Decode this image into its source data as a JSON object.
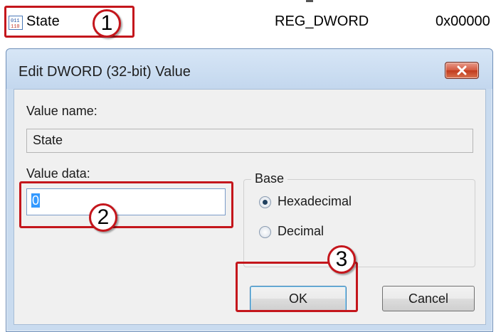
{
  "registry_row": {
    "name": "State",
    "type": "REG_DWORD",
    "data": "0x00000"
  },
  "dialog": {
    "title": "Edit DWORD (32-bit) Value",
    "value_name_label": "Value name:",
    "value_name": "State",
    "value_data_label": "Value data:",
    "value_data": "0",
    "base": {
      "legend": "Base",
      "options": [
        {
          "label": "Hexadecimal",
          "checked": true
        },
        {
          "label": "Decimal",
          "checked": false
        }
      ]
    },
    "ok_label": "OK",
    "cancel_label": "Cancel"
  },
  "annotations": [
    {
      "number": "1"
    },
    {
      "number": "2"
    },
    {
      "number": "3"
    }
  ],
  "colors": {
    "annotation_red": "#c4161c",
    "dialog_frame": "#c9dbef",
    "close_button": "#c13a1d"
  }
}
